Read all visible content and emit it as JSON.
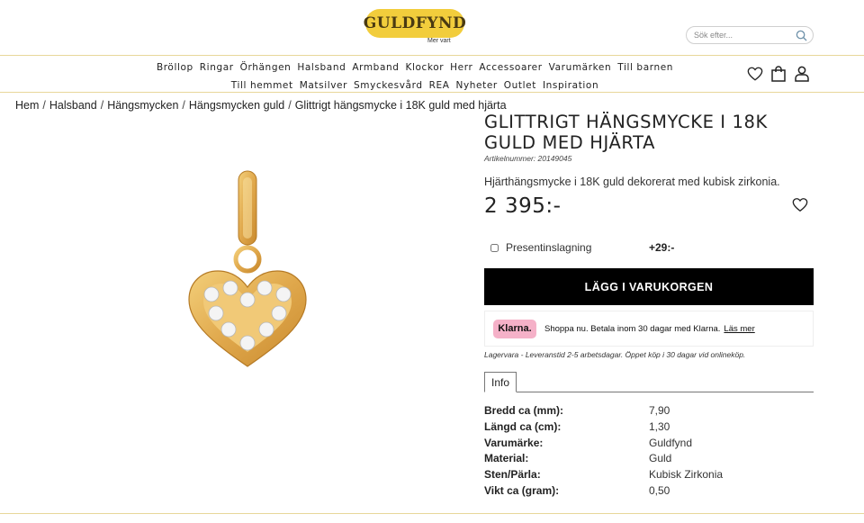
{
  "header": {
    "logo_text": "GULDFYND",
    "logo_tagline": "Mer vart",
    "search_placeholder": "Sök efter..."
  },
  "nav": {
    "row1": [
      "Bröllop",
      "Ringar",
      "Örhängen",
      "Halsband",
      "Armband",
      "Klockor",
      "Herr",
      "Accessoarer",
      "Varumärken",
      "Till barnen"
    ],
    "row2": [
      "Till hemmet",
      "Matsilver",
      "Smyckesvård",
      "REA",
      "Nyheter",
      "Outlet",
      "Inspiration"
    ],
    "icons": [
      "heart-icon",
      "shopping-bag-icon",
      "user-icon"
    ]
  },
  "breadcrumb": [
    "Hem",
    "Halsband",
    "Hängsmycken",
    "Hängsmycken guld",
    "Glittrigt hängsmycke i 18K guld med hjärta"
  ],
  "product": {
    "title": "GLITTRIGT HÄNGSMYCKE I 18K GULD MED HJÄRTA",
    "article_number": "Artikelnummer: 20149045",
    "description": "Hjärthängsmycke i 18K guld dekorerat med kubisk zirkonia.",
    "price": "2 395:-",
    "gift_wrap_label": "Presentinslagning",
    "gift_wrap_price": "+29:-",
    "gift_wrap_checked": false,
    "buy_button": "LÄGG I VARUKORGEN",
    "klarna_badge": "Klarna.",
    "klarna_text": "Shoppa nu. Betala inom 30 dagar med Klarna.",
    "klarna_link": "Läs mer",
    "stock_text": "Lagervara - Leveranstid 2-5 arbetsdagar. Öppet köp i 30 dagar vid onlineköp."
  },
  "tabs": [
    "Info"
  ],
  "specs": [
    {
      "label": "Bredd ca (mm):",
      "value": "7,90"
    },
    {
      "label": "Längd ca (cm):",
      "value": "1,30"
    },
    {
      "label": "Varumärke:",
      "value": "Guldfynd"
    },
    {
      "label": "Material:",
      "value": "Guld"
    },
    {
      "label": "Sten/Pärla:",
      "value": "Kubisk Zirkonia"
    },
    {
      "label": "Vikt ca (gram):",
      "value": "0,50"
    }
  ],
  "colors": {
    "logo_yellow": "#f2cd3c",
    "divider_gold": "#e8d79a",
    "buy_button": "#000000",
    "klarna_pink": "#f5b1c8",
    "gold_metal": "#e0a84c"
  }
}
